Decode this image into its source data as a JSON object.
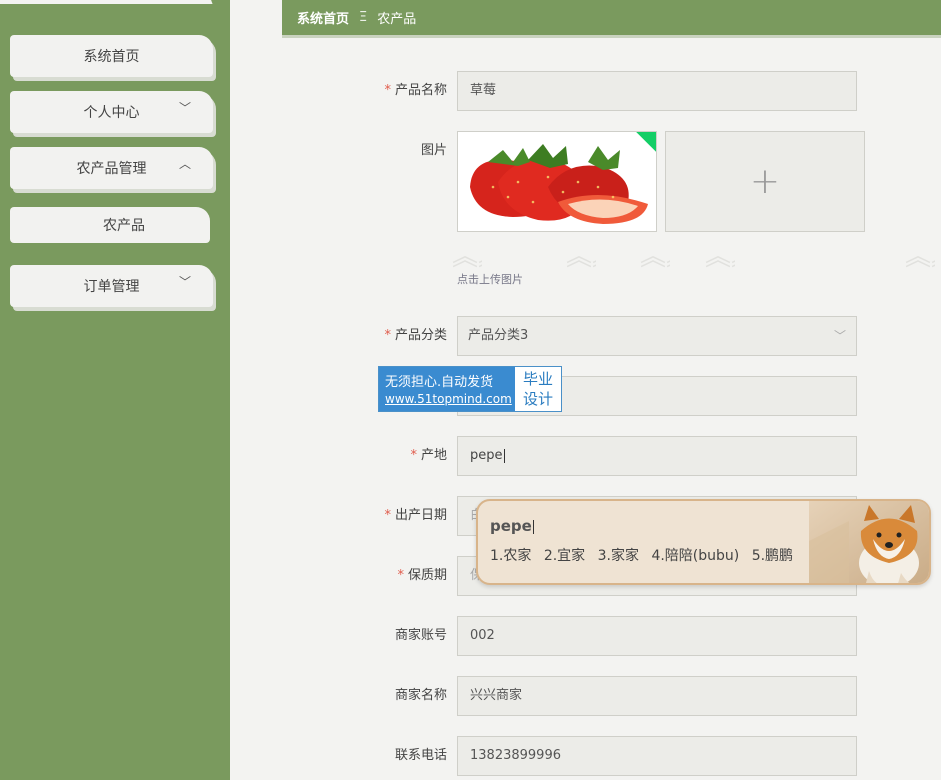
{
  "breadcrumb": {
    "home": "系统首页",
    "separator": "Ξ",
    "current": "农产品"
  },
  "sidebar": {
    "items": [
      {
        "label": "系统首页",
        "chevron": ""
      },
      {
        "label": "个人中心",
        "chevron": "﹀"
      },
      {
        "label": "农产品管理",
        "chevron": "︿"
      },
      {
        "label": "农产品",
        "chevron": ""
      },
      {
        "label": "订单管理",
        "chevron": "﹀"
      }
    ]
  },
  "form": {
    "name": {
      "label": "产品名称",
      "value": "草莓",
      "required": true
    },
    "image": {
      "label": "图片",
      "upload_hint": "点击上传图片",
      "add_symbol": "+"
    },
    "category": {
      "label": "产品分类",
      "value": "产品分类3",
      "required": true,
      "arrow": "﹀"
    },
    "origin": {
      "label": "产地",
      "value": "pepe",
      "required": true
    },
    "date": {
      "label": "出产日期",
      "placeholder": "白",
      "required": true
    },
    "shelf": {
      "label": "保质期",
      "placeholder": "保",
      "required": true
    },
    "merchant_account": {
      "label": "商家账号",
      "value": "002"
    },
    "merchant_name": {
      "label": "商家名称",
      "value": "兴兴商家"
    },
    "phone": {
      "label": "联系电话",
      "value": "13823899996"
    }
  },
  "watermark": {
    "line1": "无须担心.自动发货",
    "url": "www.51topmind.com",
    "right1": "毕业",
    "right2": "设计"
  },
  "ime": {
    "composition": "pepe",
    "candidates": [
      "1.农家",
      "2.宜家",
      "3.家家",
      "4.陪陪(bubu)",
      "5.鹏鹏"
    ],
    "arrows": "◀▶"
  },
  "colors": {
    "accent": "#7a9a5e",
    "required": "#e05a4a",
    "watermark_blue": "#3a8bd0"
  }
}
